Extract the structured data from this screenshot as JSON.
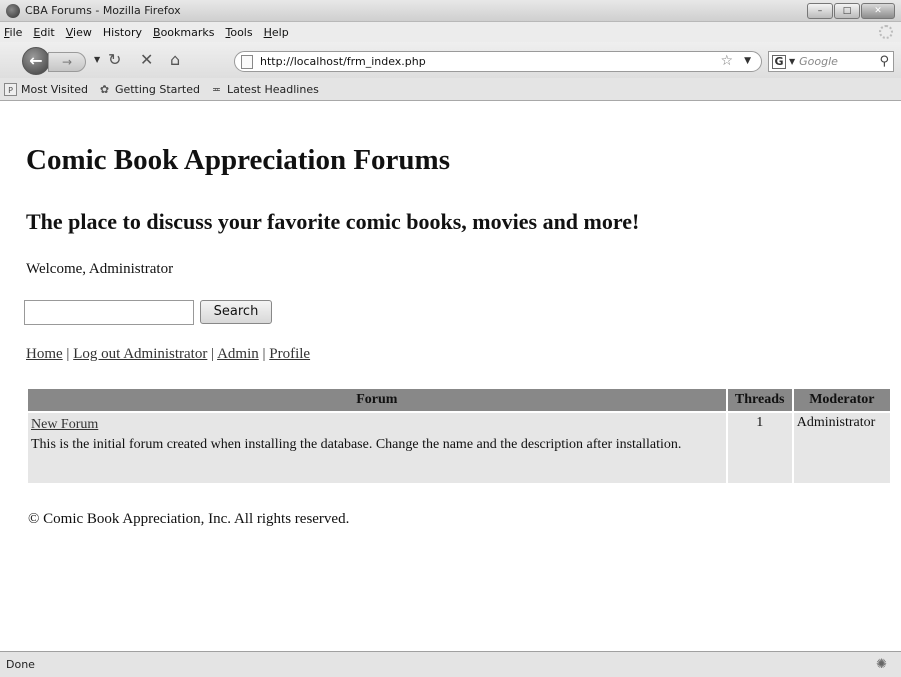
{
  "window": {
    "title": "CBA Forums - Mozilla Firefox",
    "controls": {
      "minimize": "–",
      "maximize": "□",
      "close": "✕"
    }
  },
  "menu": {
    "items": [
      {
        "label": "File",
        "mnemonic": "F",
        "rest": "ile"
      },
      {
        "label": "Edit",
        "mnemonic": "E",
        "rest": "dit"
      },
      {
        "label": "View",
        "mnemonic": "V",
        "rest": "iew"
      },
      {
        "label": "History",
        "mnemonic": "H",
        "rest": "istory"
      },
      {
        "label": "Bookmarks",
        "mnemonic": "B",
        "rest": "ookmarks"
      },
      {
        "label": "Tools",
        "mnemonic": "T",
        "rest": "ools"
      },
      {
        "label": "Help",
        "mnemonic": "H",
        "rest": "elp"
      }
    ]
  },
  "navigation": {
    "url": "http://localhost/frm_index.php",
    "search_placeholder": "Google",
    "search_engine_badge": "G"
  },
  "bookmarks": {
    "items": [
      "Most Visited",
      "Getting Started",
      "Latest Headlines"
    ]
  },
  "page": {
    "heading": "Comic Book Appreciation Forums",
    "subheading": "The place to discuss your favorite comic books, movies and more!",
    "welcome": "Welcome, Administrator",
    "search_button": "Search",
    "search_value": "",
    "nav_links": {
      "home": "Home",
      "logout": "Log out Administrator",
      "admin": "Admin",
      "profile": "Profile",
      "separator": "|"
    },
    "table": {
      "headers": {
        "forum": "Forum",
        "threads": "Threads",
        "moderator": "Moderator"
      },
      "rows": [
        {
          "name": "New Forum",
          "description": "This is the initial forum created when installing the database. Change the name and the description after installation.",
          "threads": "1",
          "moderator": "Administrator"
        }
      ]
    },
    "footer": "© Comic Book Appreciation, Inc. All rights reserved."
  },
  "status": {
    "text": "Done"
  }
}
